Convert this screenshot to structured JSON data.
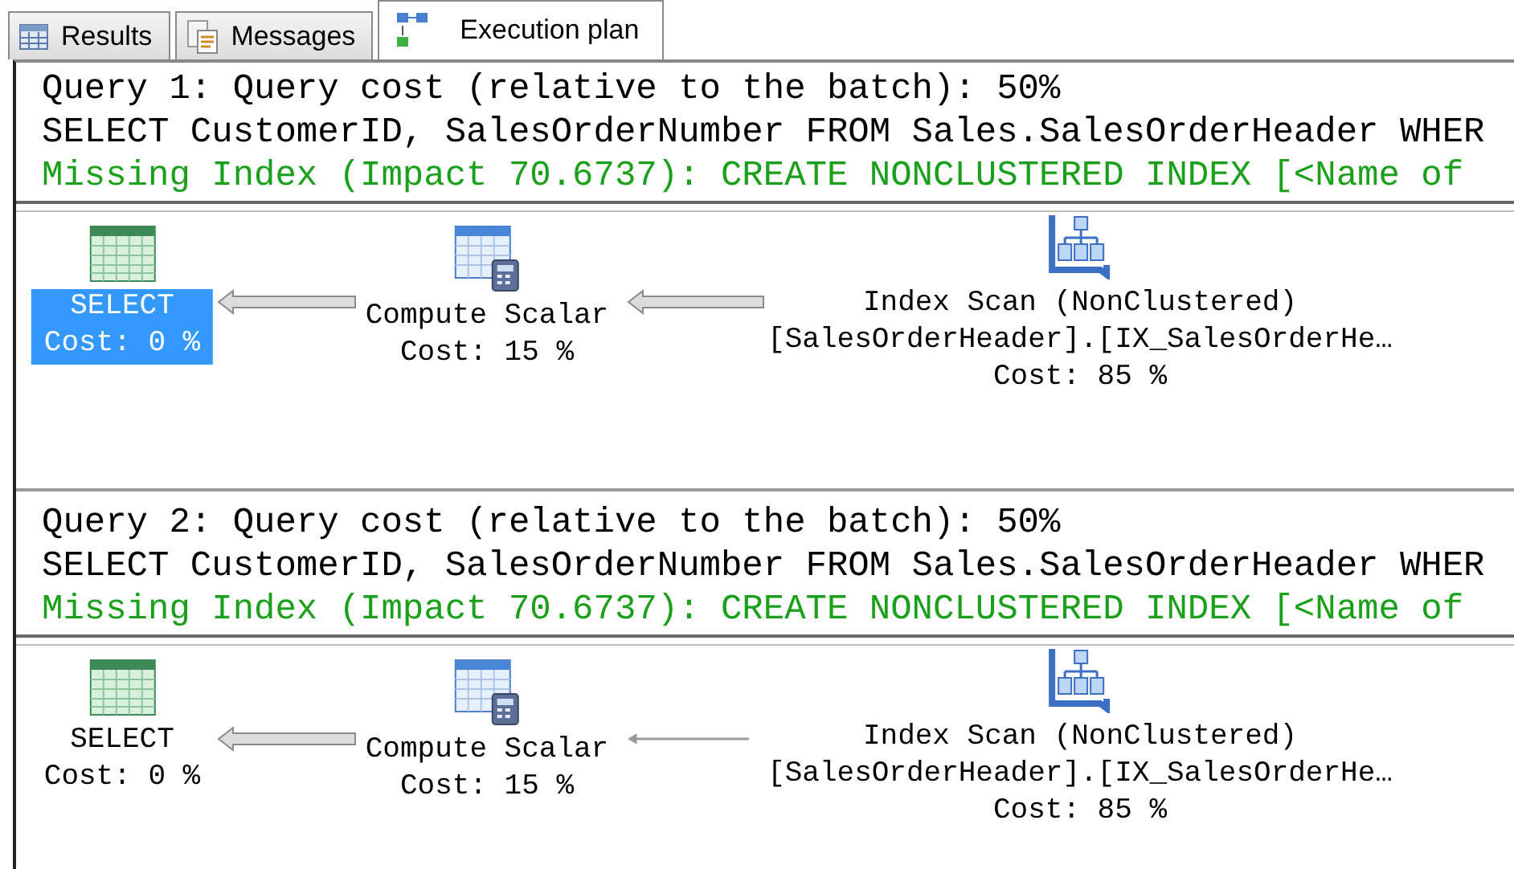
{
  "tabs": [
    {
      "label": "Results",
      "kind": "grid",
      "selected": false
    },
    {
      "label": "Messages",
      "kind": "document",
      "selected": false
    },
    {
      "label": "Execution plan",
      "kind": "plan",
      "selected": true
    }
  ],
  "queries": [
    {
      "header": "Query 1: Query cost (relative to the batch): 50%",
      "sql": "SELECT CustomerID, SalesOrderNumber FROM Sales.SalesOrderHeader WHER",
      "missing_index": "Missing Index (Impact 70.6737): CREATE NONCLUSTERED INDEX [<Name of",
      "nodes": [
        {
          "kind": "select",
          "lines": [
            "SELECT",
            "Cost: 0 %"
          ],
          "selected": true
        },
        {
          "kind": "compute",
          "lines": [
            "Compute Scalar",
            "Cost: 15 %"
          ],
          "selected": false
        },
        {
          "kind": "index_scan",
          "lines": [
            "Index Scan (NonClustered)",
            "[SalesOrderHeader].[IX_SalesOrderHe…",
            "Cost: 85 %"
          ],
          "selected": false
        }
      ],
      "arrows": [
        {
          "kind": "thick"
        },
        {
          "kind": "thick"
        }
      ]
    },
    {
      "header": "Query 2: Query cost (relative to the batch): 50%",
      "sql": "SELECT CustomerID, SalesOrderNumber FROM Sales.SalesOrderHeader WHER",
      "missing_index": "Missing Index (Impact 70.6737): CREATE NONCLUSTERED INDEX [<Name of",
      "nodes": [
        {
          "kind": "select",
          "lines": [
            "SELECT",
            "Cost: 0 %"
          ],
          "selected": false
        },
        {
          "kind": "compute",
          "lines": [
            "Compute Scalar",
            "Cost: 15 %"
          ],
          "selected": false
        },
        {
          "kind": "index_scan",
          "lines": [
            "Index Scan (NonClustered)",
            "[SalesOrderHeader].[IX_SalesOrderHe…",
            "Cost: 85 %"
          ],
          "selected": false
        }
      ],
      "arrows": [
        {
          "kind": "thick"
        },
        {
          "kind": "thin"
        }
      ]
    }
  ]
}
